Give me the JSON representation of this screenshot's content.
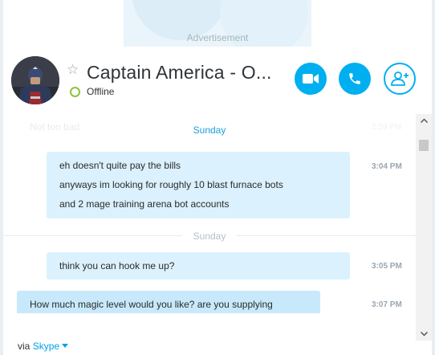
{
  "ad": {
    "label": "Advertisement"
  },
  "header": {
    "contact_name": "Captain America - O...",
    "status": "Offline",
    "accent_color": "#00aff0",
    "presence_color": "#8cc43f"
  },
  "chat": {
    "ghost_text": "Not too bad",
    "ghost_time": "2:59 PM",
    "groups": [
      {
        "day": "Sunday",
        "messages": [
          {
            "direction": "outgoing",
            "lines": [
              "eh doesn't quite pay the bills",
              "anyways im looking for roughly 10 blast furnace bots",
              "and 2 mage training arena bot accounts"
            ],
            "time": "3:04 PM"
          }
        ]
      },
      {
        "day": "Sunday",
        "messages": [
          {
            "direction": "outgoing",
            "lines": [
              "think you can hook me up?"
            ],
            "time": "3:05 PM"
          },
          {
            "direction": "incoming",
            "lines": [
              "How much magic level would you like? are you supplying"
            ],
            "time": "3:07 PM"
          }
        ]
      }
    ]
  },
  "footer": {
    "via": "via",
    "network": "Skype"
  }
}
